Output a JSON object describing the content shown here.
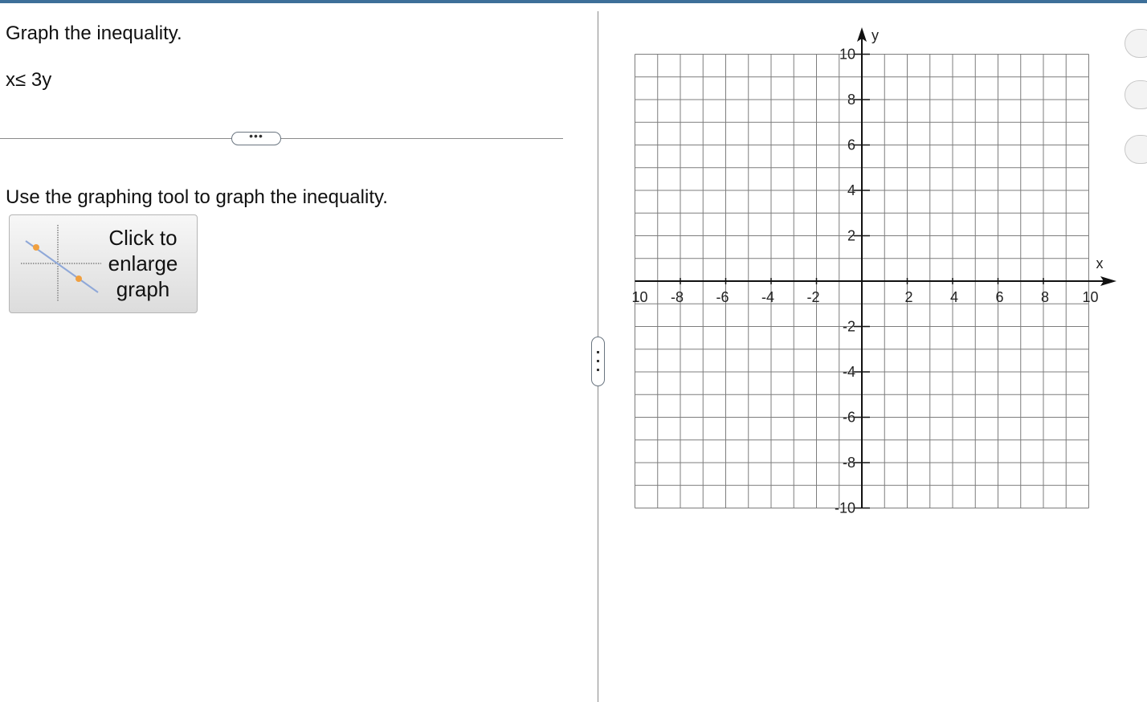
{
  "question": {
    "title": "Graph the inequality.",
    "expression": "x≤ 3y",
    "more_label": "•••",
    "instruction": "Use the graphing tool to graph the inequality.",
    "enlarge_label": "Click to enlarge graph"
  },
  "chart_data": {
    "type": "scatter",
    "xlim": [
      -10,
      10
    ],
    "ylim": [
      -10,
      10
    ],
    "grid": true,
    "grid_step": 1,
    "xlabel": "x",
    "ylabel": "y",
    "x_tick_labels": [
      "10",
      "-8",
      "-6",
      "-4",
      "-2",
      "2",
      "4",
      "6",
      "8",
      "10"
    ],
    "y_tick_labels": [
      "10",
      "8",
      "6",
      "4",
      "2",
      "-2",
      "-4",
      "-6",
      "-8",
      "-10"
    ],
    "series": []
  },
  "colors": {
    "accent_bar": "#3d6f99",
    "grid": "#7d7d7d",
    "axis": "#111111",
    "thumb_line": "#8fa8d8",
    "thumb_point": "#f0a040"
  },
  "icons": {
    "thumbnail": "graph-thumbnail-icon",
    "handle": "vertical-ellipsis-icon"
  }
}
